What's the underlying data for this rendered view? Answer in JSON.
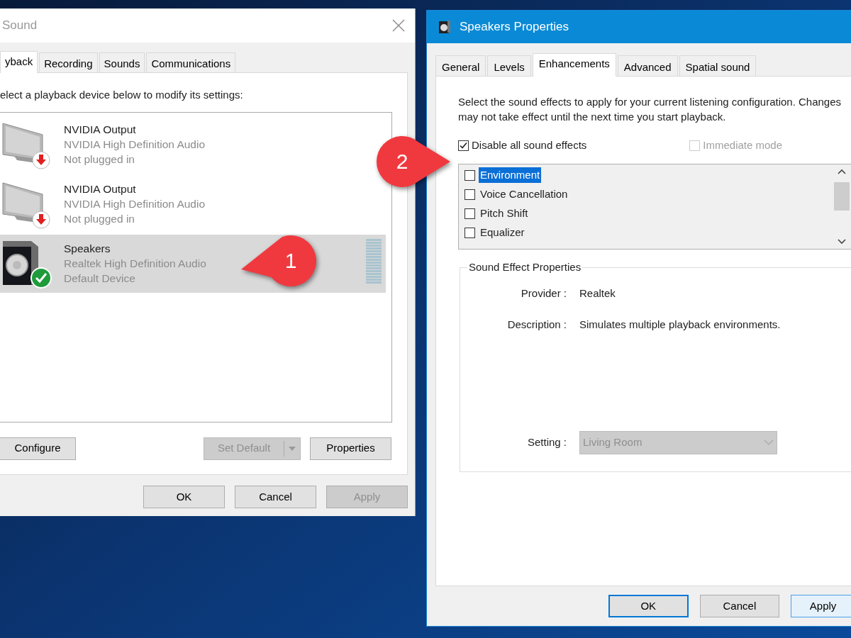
{
  "sound_window": {
    "title": "Sound",
    "tabs": [
      {
        "label": "yback",
        "selected": true
      },
      {
        "label": "Recording",
        "selected": false
      },
      {
        "label": "Sounds",
        "selected": false
      },
      {
        "label": "Communications",
        "selected": false
      }
    ],
    "instruction": "elect a playback device below to modify its settings:",
    "devices": [
      {
        "name": "NVIDIA Output",
        "driver": "NVIDIA High Definition Audio",
        "status": "Not plugged in",
        "kind": "unplugged",
        "selected": false
      },
      {
        "name": "NVIDIA Output",
        "driver": "NVIDIA High Definition Audio",
        "status": "Not plugged in",
        "kind": "unplugged",
        "selected": false
      },
      {
        "name": "Speakers",
        "driver": "Realtek High Definition Audio",
        "status": "Default Device",
        "kind": "default",
        "selected": true
      }
    ],
    "device_buttons": [
      {
        "label": "Configure",
        "kind": "plain",
        "disabled": false
      },
      {
        "label": "Set Default",
        "kind": "split",
        "disabled": true
      },
      {
        "label": "Properties",
        "kind": "plain",
        "disabled": false
      }
    ],
    "buttons": [
      {
        "label": "OK",
        "disabled": false
      },
      {
        "label": "Cancel",
        "disabled": false
      },
      {
        "label": "Apply",
        "disabled": true
      }
    ]
  },
  "properties_window": {
    "title": "Speakers Properties",
    "tabs": [
      {
        "label": "General",
        "selected": false
      },
      {
        "label": "Levels",
        "selected": false
      },
      {
        "label": "Enhancements",
        "selected": true
      },
      {
        "label": "Advanced",
        "selected": false
      },
      {
        "label": "Spatial sound",
        "selected": false
      }
    ],
    "intro": "Select the sound effects to apply for your current listening configuration. Changes may not take effect until the next time you start playback.",
    "disable_all": {
      "label": "Disable all sound effects",
      "checked": true
    },
    "immediate_mode": {
      "label": "Immediate mode",
      "checked": false,
      "disabled": true
    },
    "effects": [
      {
        "label": "Environment",
        "checked": false,
        "selected": true
      },
      {
        "label": "Voice Cancellation",
        "checked": false,
        "selected": false
      },
      {
        "label": "Pitch Shift",
        "checked": false,
        "selected": false
      },
      {
        "label": "Equalizer",
        "checked": false,
        "selected": false
      }
    ],
    "group": {
      "title": "Sound Effect Properties",
      "provider_label": "Provider :",
      "provider": "Realtek",
      "description_label": "Description :",
      "description": "Simulates multiple playback environments.",
      "setting_label": "Setting :",
      "setting": {
        "value": "Living Room",
        "disabled": true
      }
    },
    "buttons": [
      {
        "label": "OK",
        "default": true,
        "focused": false
      },
      {
        "label": "Cancel",
        "default": false,
        "focused": false
      },
      {
        "label": "Apply",
        "default": false,
        "focused": true
      }
    ]
  },
  "callouts": [
    {
      "label": "1"
    },
    {
      "label": "2"
    }
  ]
}
